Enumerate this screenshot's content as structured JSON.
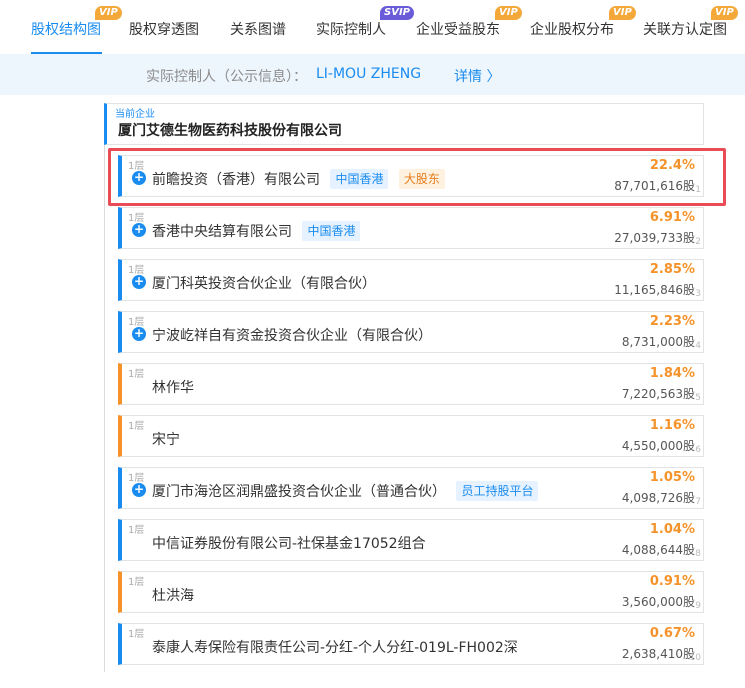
{
  "tabs": [
    {
      "label": "股权结构图",
      "badge": "VIP",
      "active": true
    },
    {
      "label": "股权穿透图",
      "badge": "",
      "active": false
    },
    {
      "label": "关系图谱",
      "badge": "",
      "active": false
    },
    {
      "label": "实际控制人",
      "badge": "SVIP",
      "active": false
    },
    {
      "label": "企业受益股东",
      "badge": "VIP",
      "active": false
    },
    {
      "label": "企业股权分布",
      "badge": "VIP",
      "active": false
    },
    {
      "label": "关联方认定图",
      "badge": "VIP",
      "active": false
    }
  ],
  "info_bar": {
    "label": "实际控制人（公示信息）：",
    "value": "LI-MOU ZHENG",
    "more": "详情 〉"
  },
  "root": {
    "tag": "当前企业",
    "name": "厦门艾德生物医药科技股份有限公司"
  },
  "shareholders": [
    {
      "level": "1层",
      "name": "前瞻投资（香港）有限公司",
      "tags": [
        "中国香港",
        "大股东"
      ],
      "percent": "22.4%",
      "shares": "87,701,616股",
      "index": "1",
      "type": "company"
    },
    {
      "level": "1层",
      "name": "香港中央结算有限公司",
      "tags": [
        "中国香港"
      ],
      "percent": "6.91%",
      "shares": "27,039,733股",
      "index": "2",
      "type": "company"
    },
    {
      "level": "1层",
      "name": "厦门科英投资合伙企业（有限合伙）",
      "tags": [],
      "percent": "2.85%",
      "shares": "11,165,846股",
      "index": "3",
      "type": "company"
    },
    {
      "level": "1层",
      "name": "宁波屹祥自有资金投资合伙企业（有限合伙）",
      "tags": [],
      "percent": "2.23%",
      "shares": "8,731,000股",
      "index": "4",
      "type": "company"
    },
    {
      "level": "1层",
      "name": "林作华",
      "tags": [],
      "percent": "1.84%",
      "shares": "7,220,563股",
      "index": "5",
      "type": "person"
    },
    {
      "level": "1层",
      "name": "宋宁",
      "tags": [],
      "percent": "1.16%",
      "shares": "4,550,000股",
      "index": "6",
      "type": "person"
    },
    {
      "level": "1层",
      "name": "厦门市海沧区润鼎盛投资合伙企业（普通合伙）",
      "tags": [
        "员工持股平台"
      ],
      "percent": "1.05%",
      "shares": "4,098,726股",
      "index": "7",
      "type": "company"
    },
    {
      "level": "1层",
      "name": "中信证券股份有限公司-社保基金17052组合",
      "tags": [],
      "percent": "1.04%",
      "shares": "4,088,644股",
      "index": "8",
      "type": "fund"
    },
    {
      "level": "1层",
      "name": "杜洪海",
      "tags": [],
      "percent": "0.91%",
      "shares": "3,560,000股",
      "index": "9",
      "type": "person"
    },
    {
      "level": "1层",
      "name": "泰康人寿保险有限责任公司-分红-个人分红-019L-FH002深",
      "tags": [],
      "percent": "0.67%",
      "shares": "2,638,410股",
      "index": "10",
      "type": "fund"
    }
  ],
  "colors": {
    "accent": "#1a8cf0",
    "percent": "#f5922a",
    "highlight": "#e94b57",
    "vip": "#f5a83a",
    "svip": "#6a5bd8"
  }
}
